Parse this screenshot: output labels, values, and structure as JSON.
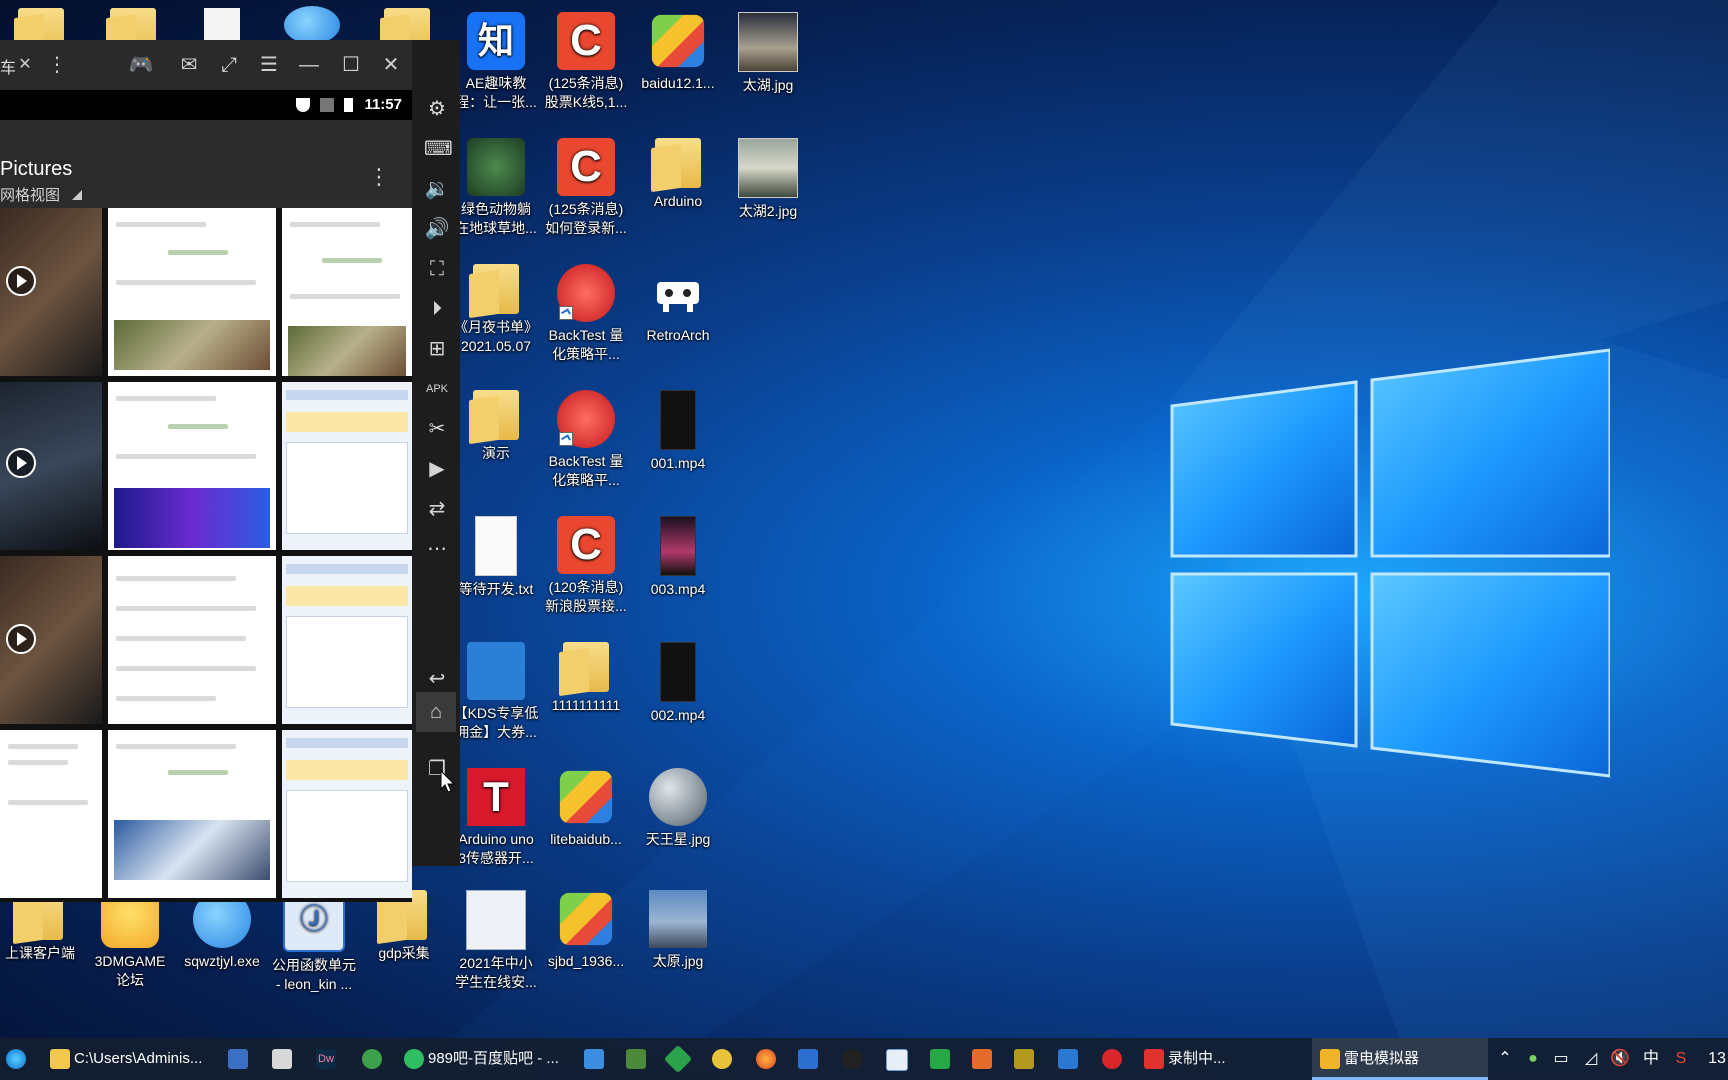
{
  "desktop": {
    "icons": [
      {
        "label": "AE趣味教\n程：让一张...",
        "icon": "zhihu-icon",
        "glyph": "知"
      },
      {
        "label": "(125条消息)\n股票K线5,1...",
        "icon": "csdn-icon",
        "glyph": "C"
      },
      {
        "label": "baidu12.1...",
        "icon": "bluestacks-icon"
      },
      {
        "label": "太湖.jpg",
        "icon": "image-icon"
      },
      {
        "label": "绿色动物躺\n在地球草地...",
        "icon": "image-icon"
      },
      {
        "label": "(125条消息)\n如何登录新...",
        "icon": "csdn-icon",
        "glyph": "C"
      },
      {
        "label": "Arduino",
        "icon": "folder-icon"
      },
      {
        "label": "太湖2.jpg",
        "icon": "image-icon"
      },
      {
        "label": "《月夜书单》\n2021.05.07",
        "icon": "folder-icon"
      },
      {
        "label": "BackTest 量\n化策略平...",
        "icon": "backtest-icon"
      },
      {
        "label": "RetroArch",
        "icon": "retroarch-icon"
      },
      {
        "label": "演示",
        "icon": "folder-icon"
      },
      {
        "label": "BackTest 量\n化策略平...",
        "icon": "backtest-icon"
      },
      {
        "label": "001.mp4",
        "icon": "video-icon"
      },
      {
        "label": "等待开发.txt",
        "icon": "text-file-icon"
      },
      {
        "label": "(120条消息)\n新浪股票接...",
        "icon": "csdn-icon",
        "glyph": "C"
      },
      {
        "label": "003.mp4",
        "icon": "video-icon"
      },
      {
        "label": "【KDS专享低\n佣金】大券...",
        "icon": "kds-icon"
      },
      {
        "label": "1111111111",
        "icon": "folder-icon"
      },
      {
        "label": "002.mp4",
        "icon": "video-icon"
      },
      {
        "label": "Arduino uno\n3传感器开...",
        "icon": "tee-icon",
        "glyph": "T"
      },
      {
        "label": "litebaidub...",
        "icon": "bluestacks-icon"
      },
      {
        "label": "天王星.jpg",
        "icon": "planet-icon"
      },
      {
        "label": "上课客户端",
        "icon": "folder-icon"
      },
      {
        "label": "3DMGAME\n论坛",
        "icon": "weather-icon"
      },
      {
        "label": "sqwztjyl.exe",
        "icon": "people-icon"
      },
      {
        "label": "公用函数单元\n- leon_kin ...",
        "icon": "app-icon",
        "glyph": "Ⓙ"
      },
      {
        "label": "gdp采集",
        "icon": "folder-icon"
      },
      {
        "label": "2021年中小\n学生在线安...",
        "icon": "document-icon"
      },
      {
        "label": "sjbd_1936...",
        "icon": "bluestacks-icon"
      },
      {
        "label": "太原.jpg",
        "icon": "image-icon"
      }
    ]
  },
  "emulator": {
    "tab_label": "车",
    "status_time": "11:57",
    "gallery_title": "Pictures",
    "gallery_view": "网格视图"
  },
  "taskbar": {
    "items": [
      {
        "label": "C:\\Users\\Adminis..."
      },
      {
        "label": "989吧-百度贴吧 - ..."
      },
      {
        "label": "录制中..."
      },
      {
        "label": "雷电模拟器"
      }
    ],
    "ime": "中",
    "clock": "13"
  }
}
